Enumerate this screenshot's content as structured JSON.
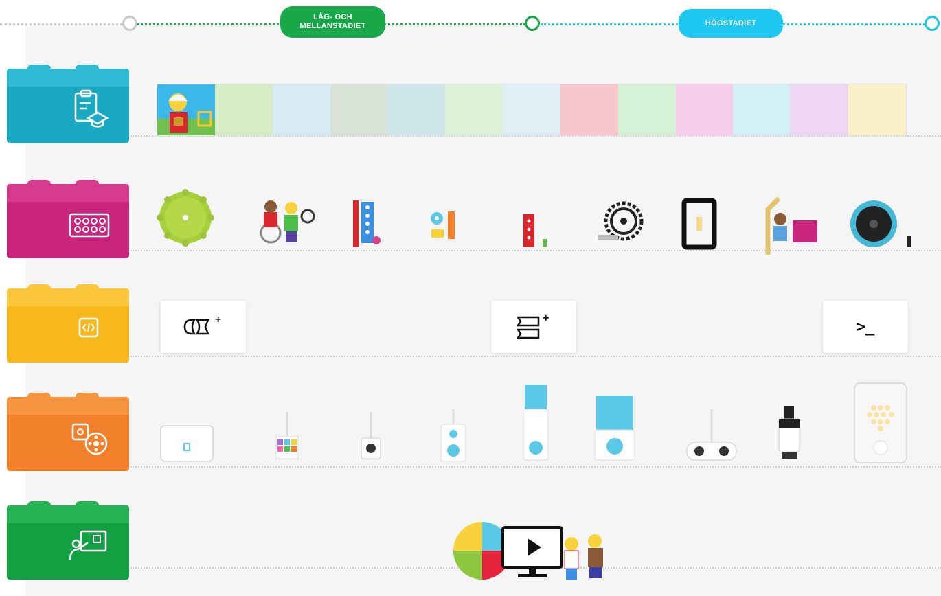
{
  "timeline": {
    "stage_primary_label": "LÅG- OCH MELLANSTADIET",
    "stage_secondary_label": "HÖGSTADIET",
    "colors": {
      "primary": "#18a84a",
      "secondary": "#1ec8f0",
      "start_node": "#c8c8c8"
    }
  },
  "rows": [
    {
      "name": "lessons",
      "brick_color": "#19a9c3",
      "icon": "clipboard-graduation-cap-icon"
    },
    {
      "name": "materials",
      "brick_color": "#c8247c",
      "icon": "lego-plate-icon"
    },
    {
      "name": "coding",
      "brick_color": "#f8b81c",
      "icon": "code-brackets-icon"
    },
    {
      "name": "hardware",
      "brick_color": "#f2802a",
      "icon": "hub-motor-icon"
    },
    {
      "name": "teacher-support",
      "brick_color": "#11a142",
      "icon": "teacher-board-icon"
    }
  ],
  "lesson_strip": {
    "cell_colors": [
      "#3bb7e9",
      "#d7ebc4",
      "#d8ecf5",
      "#dae3d7",
      "#cfe6ea",
      "#def2d7",
      "#e2eef5",
      "#f6c7cd",
      "#d5f1d6",
      "#f7cdea",
      "#d2f0f6",
      "#efd6f5",
      "#fbf1c8"
    ]
  },
  "coding_tools": [
    {
      "name": "word-blocks-button",
      "icon": "word-blocks-plus-icon"
    },
    {
      "name": "icon-blocks-button",
      "icon": "icon-blocks-plus-icon"
    },
    {
      "name": "python-button",
      "label": ">_",
      "icon": "terminal-prompt-icon"
    }
  ]
}
